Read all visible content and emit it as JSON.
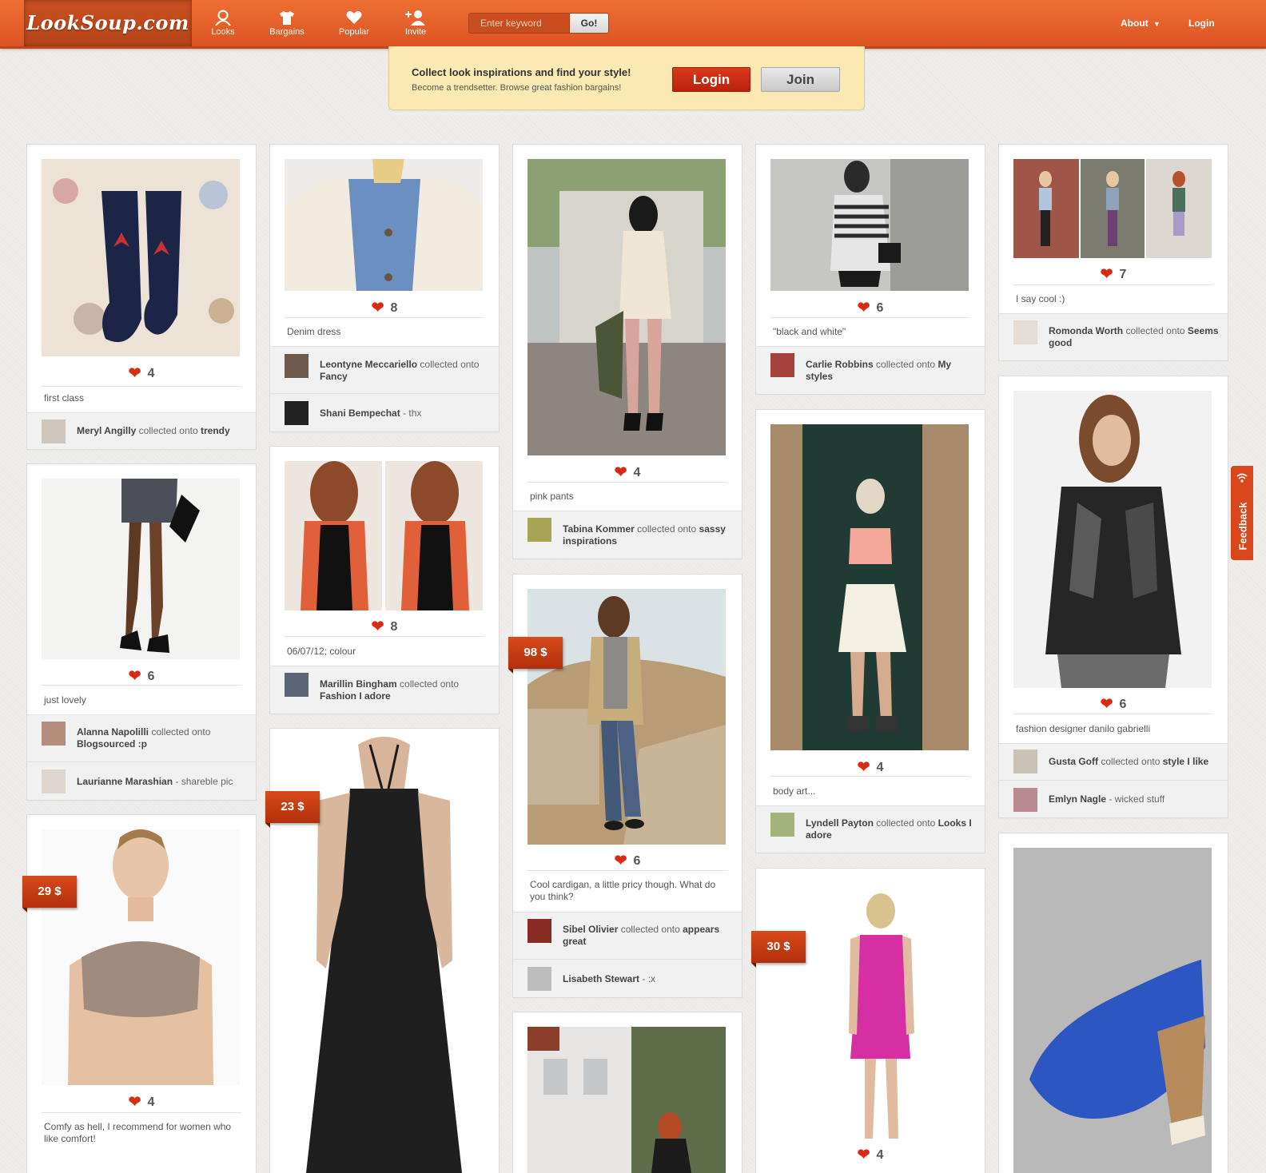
{
  "header": {
    "logo": "LookSoup.com",
    "nav": [
      "Looks",
      "Bargains",
      "Popular",
      "Invite"
    ],
    "search_placeholder": "Enter keyword",
    "search_button": "Go!",
    "about": "About",
    "login": "Login"
  },
  "banner": {
    "title": "Collect look inspirations and find your style!",
    "subtitle": "Become a trendsetter. Browse great fashion bargains!",
    "login_button": "Login",
    "join_button": "Join"
  },
  "feedback": "Feedback",
  "cards": [
    {
      "likes": "4",
      "desc": "first class",
      "a1_name": "Meryl Angilly",
      "a1_text": "collected onto",
      "a1_board": "trendy"
    },
    {
      "likes": "6",
      "desc": "just lovely",
      "a1_name": "Alanna Napolilli",
      "a1_text": "collected onto",
      "a1_board": "Blogsourced :p",
      "a2_name": "Laurianne Marashian",
      "a2_text": "- shareble pic"
    },
    {
      "likes": "4",
      "price": "29 $",
      "desc": "Comfy as hell, I recommend for women who like comfort!"
    },
    {
      "likes": "8",
      "desc": "Denim dress",
      "a1_name": "Leontyne Meccariello",
      "a1_text": "collected onto",
      "a1_board": "Fancy",
      "a2_name": "Shani Bempechat",
      "a2_text": "- thx"
    },
    {
      "likes": "8",
      "desc": "06/07/12; colour",
      "a1_name": "Marillin Bingham",
      "a1_text": "collected onto",
      "a1_board": "Fashion I adore"
    },
    {
      "price": "23 $"
    },
    {
      "likes": "4",
      "desc": "pink pants",
      "a1_name": "Tabina Kommer",
      "a1_text": "collected onto",
      "a1_board": "sassy inspirations"
    },
    {
      "likes": "6",
      "price": "98 $",
      "desc": "Cool cardigan, a little pricy though. What do you think?",
      "a1_name": "Sibel Olivier",
      "a1_text": "collected onto",
      "a1_board": "appears great",
      "a2_name": "Lisabeth Stewart",
      "a2_text": "- :x"
    },
    {},
    {
      "likes": "6",
      "desc": "\"black and white\"",
      "a1_name": "Carlie Robbins",
      "a1_text": "collected onto",
      "a1_board": "My styles"
    },
    {
      "likes": "4",
      "desc": "body art...",
      "a1_name": "Lyndell Payton",
      "a1_text": "collected onto",
      "a1_board": "Looks I adore"
    },
    {
      "likes": "4",
      "price": "30 $"
    },
    {
      "likes": "7",
      "desc": "I say cool :)",
      "a1_name": "Romonda Worth",
      "a1_text": "collected onto",
      "a1_board": "Seems good"
    },
    {
      "likes": "6",
      "desc": "fashion designer danilo gabrielli",
      "a1_name": "Gusta Goff",
      "a1_text": "collected onto",
      "a1_board": "style I like",
      "a2_name": "Emlyn Nagle",
      "a2_text": "- wicked stuff"
    },
    {}
  ]
}
